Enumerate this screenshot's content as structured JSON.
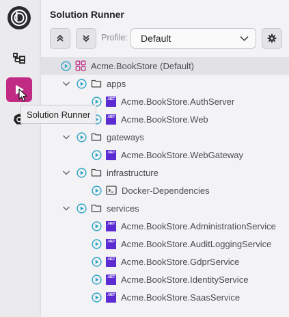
{
  "sidebar": {
    "items": [
      {
        "name": "logo"
      },
      {
        "name": "solution-explorer"
      },
      {
        "name": "solution-runner",
        "active": true
      },
      {
        "name": "kubernetes"
      }
    ],
    "tooltip": "Solution Runner",
    "active_color": "#c22b83"
  },
  "panel": {
    "title": "Solution Runner",
    "profile_label": "Profile:",
    "profile_value": "Default"
  },
  "tree": {
    "root": {
      "label": "Acme.BookStore (Default)"
    },
    "folders": [
      {
        "label": "apps",
        "children": [
          "Acme.BookStore.AuthServer",
          "Acme.BookStore.Web"
        ]
      },
      {
        "label": "gateways",
        "children": [
          "Acme.BookStore.WebGateway"
        ]
      },
      {
        "label": "infrastructure",
        "children": [
          "Docker-Dependencies"
        ]
      },
      {
        "label": "services",
        "children": [
          "Acme.BookStore.AdministrationService",
          "Acme.BookStore.AuditLoggingService",
          "Acme.BookStore.GdprService",
          "Acme.BookStore.IdentityService",
          "Acme.BookStore.SaasService"
        ]
      }
    ],
    "net_badge": ".NET",
    "play_color": "#2aa3c4"
  }
}
